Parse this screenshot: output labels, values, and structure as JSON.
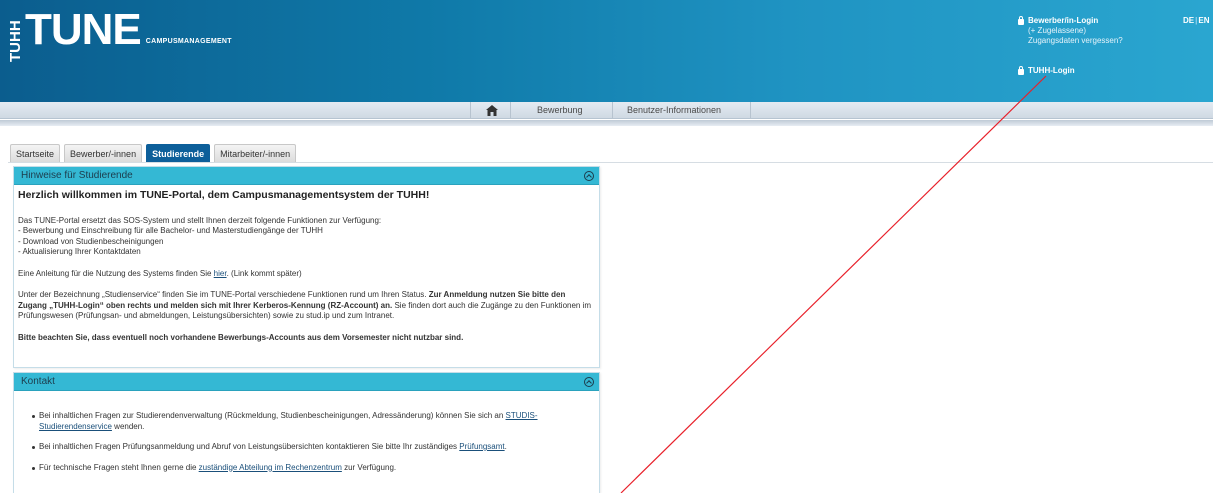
{
  "header": {
    "logo_vertical": "TUHH",
    "logo_main": "TUNE",
    "logo_sub": "CAMPUSMANAGEMENT",
    "login": {
      "applicant_login": "Bewerber/in-Login",
      "admitted": "(+ Zugelassene)",
      "forgot": "Zugangsdaten vergessen?",
      "tuhh_login": "TUHH-Login"
    },
    "lang": {
      "de": "DE",
      "sep": "|",
      "en": "EN"
    }
  },
  "nav": {
    "home_icon": "home-icon",
    "items": [
      "Bewerbung",
      "Benutzer-Informationen"
    ]
  },
  "tabs": [
    {
      "label": "Startseite",
      "active": false
    },
    {
      "label": "Bewerber/-innen",
      "active": false
    },
    {
      "label": "Studierende",
      "active": true
    },
    {
      "label": "Mitarbeiter/-innen",
      "active": false
    }
  ],
  "panel_notes": {
    "title": "Hinweise für Studierende",
    "welcome": "Herzlich willkommen im TUNE-Portal, dem Campusmanagementsystem der TUHH!",
    "intro": "Das TUNE-Portal ersetzt das SOS-System und stellt Ihnen derzeit folgende Funktionen zur Verfügung:",
    "functions": [
      "- Bewerbung und Einschreibung für alle Bachelor- und Masterstudiengänge der TUHH",
      "- Download von Studienbescheinigungen",
      "- Aktualisierung Ihrer Kontaktdaten"
    ],
    "guide_prefix": "Eine Anleitung für die Nutzung des Systems finden Sie ",
    "guide_link": "hier",
    "guide_suffix": ". (Link kommt später)",
    "service_pre": "Unter der Bezeichnung „Studienservice“ finden Sie im TUNE-Portal verschiedene Funktionen rund um Ihren Status. ",
    "service_bold": "Zur Anmeldung nutzen Sie bitte den Zugang „TUHH-Login“ oben rechts und melden sich mit Ihrer Kerberos-Kennung (RZ-Account) an.",
    "service_post": " Sie finden dort auch die Zugänge zu den Funktionen im Prüfungswesen (Prüfungsan- und abmeldungen, Leistungsübersichten) sowie zu stud.ip und zum Intranet.",
    "notice": "Bitte beachten Sie, dass eventuell noch vorhandene Bewerbungs-Accounts aus dem Vorsemester nicht nutzbar sind."
  },
  "panel_contact": {
    "title": "Kontakt",
    "item1_pre": "Bei inhaltlichen Fragen zur Studierendenverwaltung (Rückmeldung, Studienbescheinigungen, Adressänderung) können Sie sich an ",
    "item1_link": "STUDIS-Studierendenservice",
    "item1_post": " wenden.",
    "item2_pre": "Bei inhaltlichen Fragen Prüfungsanmeldung und Abruf von Leistungsübersichten kontaktieren Sie bitte Ihr zuständiges ",
    "item2_link": "Prüfungsamt",
    "item2_post": ".",
    "item3_pre": "Für technische Fragen steht Ihnen gerne die ",
    "item3_link": "zuständige Abteilung im Rechenzentrum",
    "item3_post": " zur Verfügung."
  },
  "colors": {
    "header_start": "#0b5d8e",
    "header_end": "#2aa6d0",
    "active_tab": "#0d5f9a",
    "panel_head": "#34b8d4",
    "annotation_line": "#e8202a"
  }
}
